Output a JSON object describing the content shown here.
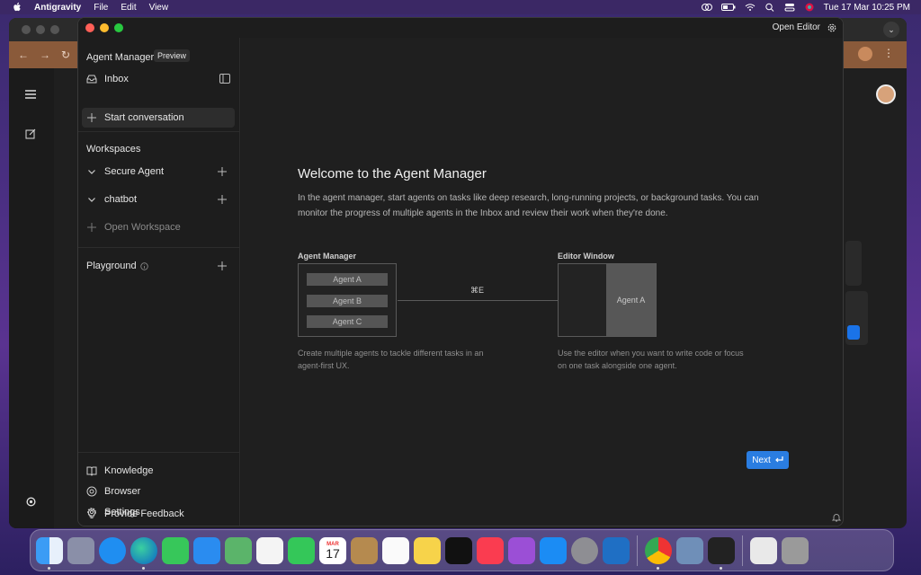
{
  "menubar": {
    "app_name": "Antigravity",
    "items": [
      "File",
      "Edit",
      "View"
    ],
    "clock": "Tue 17 Mar  10:25 PM"
  },
  "window": {
    "open_editor_label": "Open Editor"
  },
  "sidebar": {
    "header": "Agent Manager",
    "badge": "Preview",
    "inbox_label": "Inbox",
    "start_conversation_label": "Start conversation",
    "workspaces_heading": "Workspaces",
    "workspaces": [
      {
        "label": "Secure Agent"
      },
      {
        "label": "chatbot"
      }
    ],
    "open_workspace_label": "Open Workspace",
    "playground_label": "Playground",
    "footer": [
      {
        "label": "Knowledge",
        "icon": "book-icon"
      },
      {
        "label": "Browser",
        "icon": "chrome-icon"
      },
      {
        "label": "Settings",
        "icon": "gear-icon"
      },
      {
        "label": "Provide Feedback",
        "icon": "lightbulb-icon"
      }
    ]
  },
  "main": {
    "title": "Welcome to the Agent Manager",
    "description": "In the agent manager, start agents on tasks like deep research, long-running projects, or background tasks. You can monitor the progress of multiple agents in the Inbox and review their work when they're done.",
    "diagram": {
      "left_label": "Agent Manager",
      "agents": [
        "Agent A",
        "Agent B",
        "Agent C"
      ],
      "shortcut": "⌘E",
      "right_label": "Editor Window",
      "right_agent": "Agent A",
      "left_caption": "Create multiple agents to tackle different tasks in an agent-first UX.",
      "right_caption": "Use the editor when you want to write code or focus on one task alongside one agent."
    },
    "next_label": "Next"
  },
  "dock": {
    "calendar_month": "MAR",
    "calendar_day": "17"
  },
  "colors": {
    "accent": "#2a7de1",
    "window_bg": "#1d1d1d"
  }
}
